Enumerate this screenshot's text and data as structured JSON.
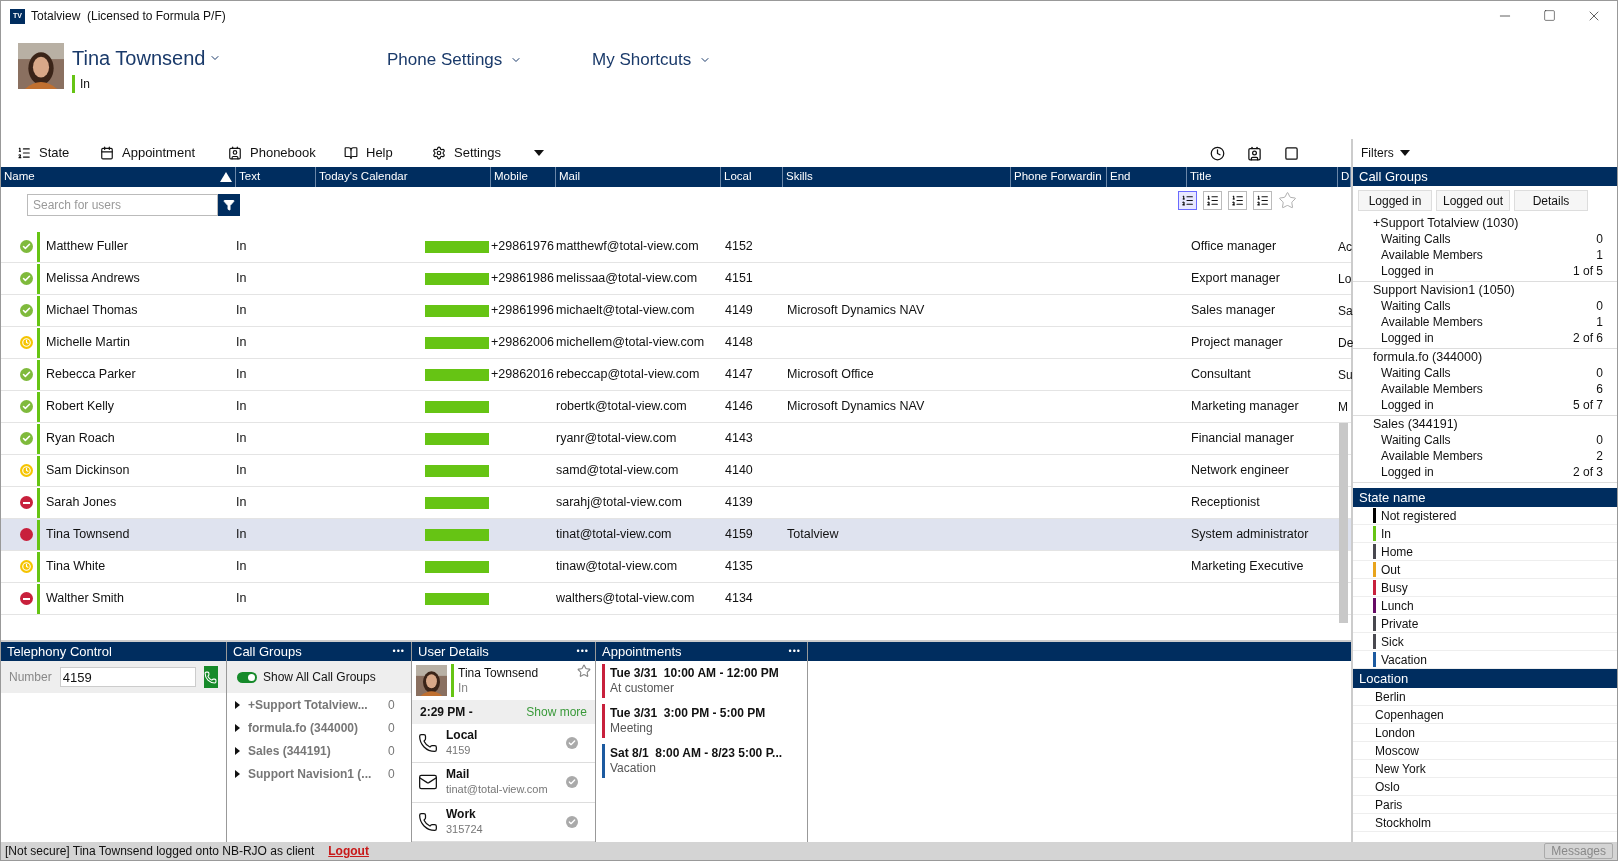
{
  "window": {
    "logo": "TV",
    "title": "Totalview  (Licensed to Formula P/F)"
  },
  "user": {
    "name": "Tina Townsend",
    "state": "In"
  },
  "menus": [
    "Phone Settings",
    "My Shortcuts"
  ],
  "toolbar": [
    "State",
    "Appointment",
    "Phonebook",
    "Help",
    "Settings"
  ],
  "filters": "Filters",
  "table": {
    "columns": [
      "Name",
      "Text",
      "Today's Calendar",
      "Mobile",
      "Mail",
      "Local",
      "Skills",
      "Phone Forwardin",
      "End",
      "Title",
      "D"
    ],
    "search": {
      "placeholder": "Search for users"
    },
    "rows": [
      {
        "name": "Matthew Fuller",
        "kind": "available",
        "text": "In",
        "mobile": "+29861976",
        "mail": "matthewf@total-view.com",
        "local": "4152",
        "skills": "",
        "title": "Office manager",
        "column_11": "Ac",
        "selected": false
      },
      {
        "name": "Melissa Andrews",
        "kind": "available",
        "text": "In",
        "mobile": "+29861986",
        "mail": "melissaa@total-view.com",
        "local": "4151",
        "skills": "",
        "title": "Export manager",
        "column_11": "Lo",
        "selected": false
      },
      {
        "name": "Michael Thomas",
        "kind": "available",
        "text": "In",
        "mobile": "+29861996",
        "mail": "michaelt@total-view.com",
        "local": "4149",
        "skills": "Microsoft Dynamics NAV",
        "title": "Sales manager",
        "column_11": "Sa",
        "selected": false
      },
      {
        "name": "Michelle Martin",
        "kind": "away",
        "text": "In",
        "mobile": "+29862006",
        "mail": "michellem@total-view.com",
        "local": "4148",
        "skills": "",
        "title": "Project manager",
        "column_11": "De",
        "selected": false
      },
      {
        "name": "Rebecca Parker",
        "kind": "available",
        "text": "In",
        "mobile": "+29862016",
        "mail": "rebeccap@total-view.com",
        "local": "4147",
        "skills": "Microsoft Office",
        "title": "Consultant",
        "column_11": "Su",
        "selected": false
      },
      {
        "name": "Robert Kelly",
        "kind": "available",
        "text": "In",
        "mobile": "",
        "mail": "robertk@total-view.com",
        "local": "4146",
        "skills": "Microsoft Dynamics NAV",
        "title": "Marketing manager",
        "column_11": "M",
        "selected": false
      },
      {
        "name": "Ryan Roach",
        "kind": "available",
        "text": "In",
        "mobile": "",
        "mail": "ryanr@total-view.com",
        "local": "4143",
        "skills": "",
        "title": "Financial manager",
        "column_11": "",
        "selected": false
      },
      {
        "name": "Sam Dickinson",
        "kind": "away",
        "text": "In",
        "mobile": "",
        "mail": "samd@total-view.com",
        "local": "4140",
        "skills": "",
        "title": "Network engineer",
        "column_11": "",
        "selected": false
      },
      {
        "name": "Sarah Jones",
        "kind": "busy",
        "text": "In",
        "mobile": "",
        "mail": "sarahj@total-view.com",
        "local": "4139",
        "skills": "",
        "title": "Receptionist",
        "column_11": "",
        "selected": false
      },
      {
        "name": "Tina Townsend",
        "kind": "self",
        "text": "In",
        "mobile": "",
        "mail": "tinat@total-view.com",
        "local": "4159",
        "skills": "Totalview",
        "title": "System administrator",
        "column_11": "",
        "selected": true
      },
      {
        "name": "Tina White",
        "kind": "away",
        "text": "In",
        "mobile": "",
        "mail": "tinaw@total-view.com",
        "local": "4135",
        "skills": "",
        "title": "Marketing Executive",
        "column_11": "",
        "selected": false
      },
      {
        "name": "Walther Smith",
        "kind": "busy",
        "text": "In",
        "mobile": "",
        "mail": "walthers@total-view.com",
        "local": "4134",
        "skills": "",
        "title": "",
        "column_11": "",
        "selected": false
      }
    ]
  },
  "call_groups_panel": {
    "title": "Call Groups",
    "buttons": [
      "Logged in",
      "Logged out",
      "Details"
    ],
    "groups": [
      {
        "name": "+Support Totalview (1030)",
        "stats": [
          {
            "label": "Waiting Calls",
            "value": "0"
          },
          {
            "label": "Available Members",
            "value": "1"
          },
          {
            "label": "Logged in",
            "value": "1 of 5"
          }
        ]
      },
      {
        "name": "Support Navision1 (1050)",
        "stats": [
          {
            "label": "Waiting Calls",
            "value": "0"
          },
          {
            "label": "Available Members",
            "value": "1"
          },
          {
            "label": "Logged in",
            "value": "2 of 6"
          }
        ]
      },
      {
        "name": "formula.fo (344000)",
        "stats": [
          {
            "label": "Waiting Calls",
            "value": "0"
          },
          {
            "label": "Available Members",
            "value": "6"
          },
          {
            "label": "Logged in",
            "value": "5 of 7"
          }
        ]
      },
      {
        "name": "Sales (344191)",
        "stats": [
          {
            "label": "Waiting Calls",
            "value": "0"
          },
          {
            "label": "Available Members",
            "value": "2"
          },
          {
            "label": "Logged in",
            "value": "2 of 3"
          }
        ]
      }
    ]
  },
  "state_panel": {
    "title": "State name",
    "states": [
      {
        "name": "Not registered",
        "color": "#000000"
      },
      {
        "name": "In",
        "color": "#66c414"
      },
      {
        "name": "Home",
        "color": "#48484f"
      },
      {
        "name": "Out",
        "color": "#e8a41c"
      },
      {
        "name": "Busy",
        "color": "#c8203c"
      },
      {
        "name": "Lunch",
        "color": "#660a64"
      },
      {
        "name": "Private",
        "color": "#47474e"
      },
      {
        "name": "Sick",
        "color": "#494950"
      },
      {
        "name": "Vacation",
        "color": "#1c5aa0"
      }
    ]
  },
  "location_panel": {
    "title": "Location",
    "locations": [
      "Berlin",
      "Copenhagen",
      "London",
      "Moscow",
      "New York",
      "Oslo",
      "Paris",
      "Stockholm"
    ]
  },
  "telephony": {
    "title": "Telephony Control",
    "number_label": "Number",
    "number": "4159"
  },
  "call_groups": {
    "title": "Call Groups",
    "menu": "•••",
    "toggle": {
      "label": "Show All Call Groups",
      "on": true
    },
    "items": [
      {
        "name": "+Support  Totalview...",
        "count": "0"
      },
      {
        "name": "formula.fo (344000)",
        "count": "0"
      },
      {
        "name": "Sales (344191)",
        "count": "0"
      },
      {
        "name": "Support  Navision1  (...",
        "count": "0"
      }
    ]
  },
  "user_details": {
    "title": "User Details",
    "menu": "•••",
    "name": "Tina Townsend",
    "state": "In",
    "time": "2:29 PM -",
    "show_more": "Show more",
    "contacts": [
      {
        "kind": "phone",
        "label": "Local",
        "value": "4159"
      },
      {
        "kind": "mail",
        "label": "Mail",
        "value": "tinat@total-view.com"
      },
      {
        "kind": "phone",
        "label": "Work",
        "value": "315724"
      }
    ]
  },
  "appointments": {
    "title": "Appointments",
    "menu": "•••",
    "items": [
      {
        "time": "Tue 3/31  10:00 AM - 12:00 PM",
        "text": "At customer",
        "color": "#c8203c"
      },
      {
        "time": "Tue 3/31  3:00 PM - 5:00 PM",
        "text": "Meeting",
        "color": "#c8203c"
      },
      {
        "time": "Sat 8/1  8:00 AM - 8/23 5:00 P...",
        "text": "Vacation",
        "color": "#1c5aa0"
      }
    ]
  },
  "status_bar": {
    "text": "[Not secure] Tina Townsend logged onto NB-RJO as client",
    "link": "Logout",
    "button": "Messages"
  }
}
